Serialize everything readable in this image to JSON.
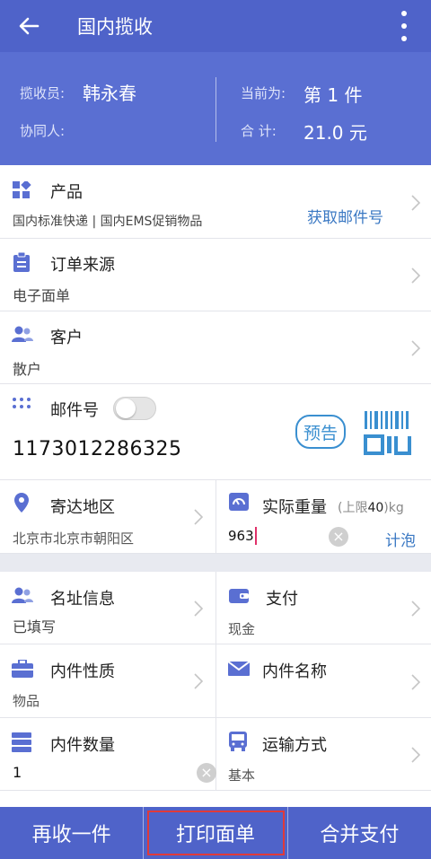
{
  "header": {
    "title": "国内揽收"
  },
  "summary": {
    "collector_label": "揽收员:",
    "collector_name": "韩永春",
    "assistant_label": "协同人:",
    "current_label": "当前为:",
    "current_value": "第 1 件",
    "total_label": "合 计:",
    "total_value": "21.0 元"
  },
  "product": {
    "label": "产品",
    "value": "国内标准快递 | 国内EMS促销物品",
    "link": "获取邮件号"
  },
  "order_source": {
    "label": "订单来源",
    "value": "电子面单"
  },
  "customer": {
    "label": "客户",
    "value": "散户"
  },
  "mail_no": {
    "label": "邮件号",
    "value": "1173012286325",
    "forecast": "预告"
  },
  "destination": {
    "label": "寄达地区",
    "value": "北京市北京市朝阳区"
  },
  "weight": {
    "label": "实际重量",
    "limit_prefix": "(上限",
    "limit_value": "40",
    "limit_suffix": ")kg",
    "value": "963",
    "foam_link": "计泡"
  },
  "address_info": {
    "label": "名址信息",
    "value": "已填写"
  },
  "payment": {
    "label": "支付",
    "value": "现金"
  },
  "content_type": {
    "label": "内件性质",
    "value": "物品"
  },
  "content_name": {
    "label": "内件名称",
    "value": ""
  },
  "content_qty": {
    "label": "内件数量",
    "value": "1"
  },
  "transport": {
    "label": "运输方式",
    "value": "基本"
  },
  "bottom": {
    "again": "再收一件",
    "print": "打印面单",
    "merge": "合并支付"
  },
  "colors": {
    "primary": "#4f63c9",
    "accent": "#3a78c3",
    "highlight": "#e03a3a"
  }
}
